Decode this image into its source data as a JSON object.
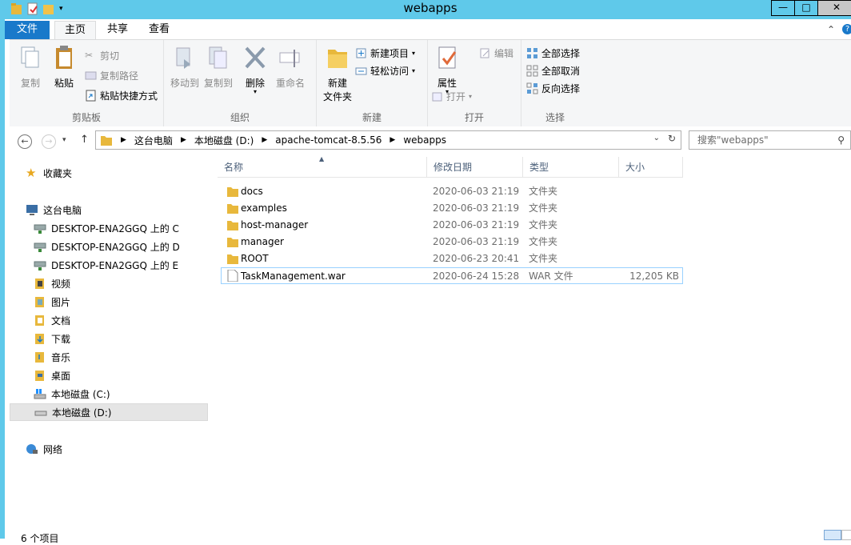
{
  "window": {
    "title": "webapps"
  },
  "titlebar": {
    "minimize": "—",
    "maximize": "□",
    "close": "✕"
  },
  "tabs": {
    "file": "文件",
    "home": "主页",
    "share": "共享",
    "view": "查看"
  },
  "ribbon": {
    "clipboard": {
      "label": "剪贴板",
      "copy": "复制",
      "paste": "粘贴",
      "cut": "剪切",
      "copy_path": "复制路径",
      "paste_shortcut": "粘贴快捷方式"
    },
    "organize": {
      "label": "组织",
      "move_to": "移动到",
      "copy_to": "复制到",
      "delete": "删除",
      "rename": "重命名"
    },
    "new": {
      "label": "新建",
      "new_folder_line1": "新建",
      "new_folder_line2": "文件夹",
      "new_item": "新建项目",
      "easy_access": "轻松访问"
    },
    "open": {
      "label": "打开",
      "properties": "属性",
      "open": "打开",
      "edit": "编辑"
    },
    "select": {
      "label": "选择",
      "select_all": "全部选择",
      "select_none": "全部取消",
      "invert": "反向选择"
    }
  },
  "address": {
    "crumbs": [
      "这台电脑",
      "本地磁盘 (D:)",
      "apache-tomcat-8.5.56",
      "webapps"
    ]
  },
  "search": {
    "placeholder": "搜索\"webapps\""
  },
  "navpane": {
    "favorites": "收藏夹",
    "this_pc": "这台电脑",
    "items": [
      "DESKTOP-ENA2GGQ 上的 C",
      "DESKTOP-ENA2GGQ 上的 D",
      "DESKTOP-ENA2GGQ 上的 E",
      "视频",
      "图片",
      "文档",
      "下载",
      "音乐",
      "桌面",
      "本地磁盘 (C:)",
      "本地磁盘 (D:)"
    ],
    "network": "网络"
  },
  "columns": {
    "name": "名称",
    "date": "修改日期",
    "type": "类型",
    "size": "大小"
  },
  "files": [
    {
      "name": "docs",
      "date": "2020-06-03 21:19",
      "type": "文件夹",
      "size": ""
    },
    {
      "name": "examples",
      "date": "2020-06-03 21:19",
      "type": "文件夹",
      "size": ""
    },
    {
      "name": "host-manager",
      "date": "2020-06-03 21:19",
      "type": "文件夹",
      "size": ""
    },
    {
      "name": "manager",
      "date": "2020-06-03 21:19",
      "type": "文件夹",
      "size": ""
    },
    {
      "name": "ROOT",
      "date": "2020-06-23 20:41",
      "type": "文件夹",
      "size": ""
    },
    {
      "name": "TaskManagement.war",
      "date": "2020-06-24 15:28",
      "type": "WAR 文件",
      "size": "12,205 KB"
    }
  ],
  "status": {
    "count": "6 个项目"
  },
  "colors": {
    "accent": "#1979ca",
    "frame": "#5fc9ea",
    "folder": "#e8b83c"
  }
}
